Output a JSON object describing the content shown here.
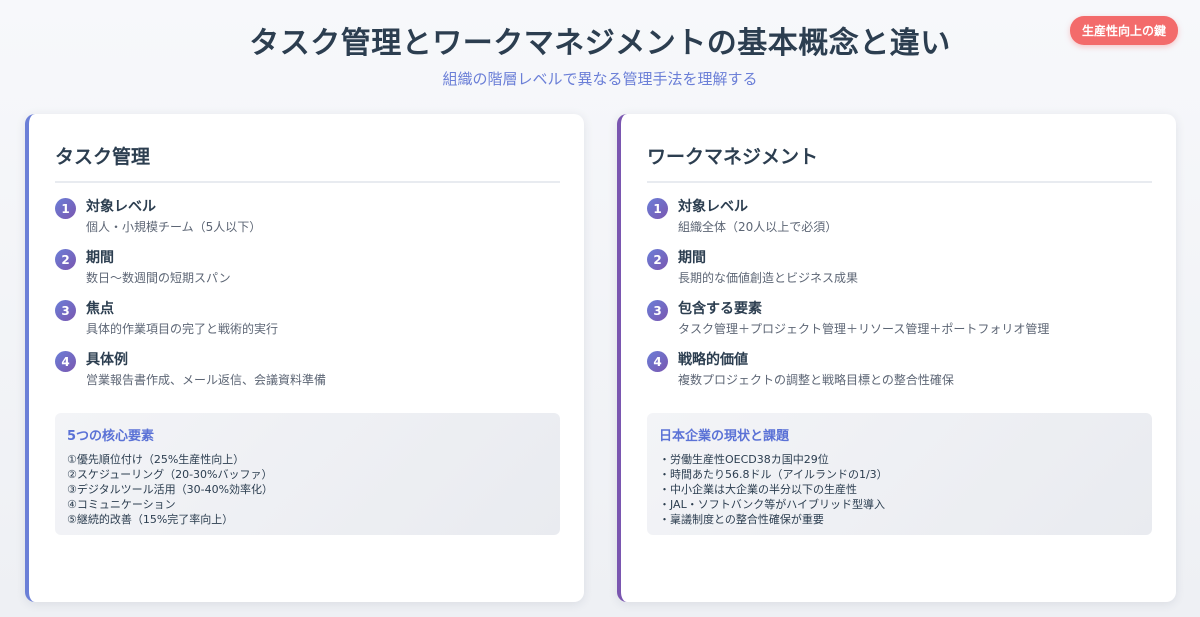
{
  "header": {
    "title": "タスク管理とワークマネジメントの基本概念と違い",
    "subtitle": "組織の階層レベルで異なる管理手法を理解する",
    "badge": "生産性向上の鍵"
  },
  "left": {
    "title": "タスク管理",
    "items": [
      {
        "num": "1",
        "label": "対象レベル",
        "desc": "個人・小規模チーム（5人以下）"
      },
      {
        "num": "2",
        "label": "期間",
        "desc": "数日〜数週間の短期スパン"
      },
      {
        "num": "3",
        "label": "焦点",
        "desc": "具体的作業項目の完了と戦術的実行"
      },
      {
        "num": "4",
        "label": "具体例",
        "desc": "営業報告書作成、メール返信、会議資料準備"
      }
    ],
    "box": {
      "title": "5つの核心要素",
      "lines": [
        "①優先順位付け（25%生産性向上）",
        "②スケジューリング（20-30%バッファ）",
        "③デジタルツール活用（30-40%効率化）",
        "④コミュニケーション",
        "⑤継続的改善（15%完了率向上）"
      ]
    }
  },
  "right": {
    "title": "ワークマネジメント",
    "items": [
      {
        "num": "1",
        "label": "対象レベル",
        "desc": "組織全体（20人以上で必須）"
      },
      {
        "num": "2",
        "label": "期間",
        "desc": "長期的な価値創造とビジネス成果"
      },
      {
        "num": "3",
        "label": "包含する要素",
        "desc": "タスク管理＋プロジェクト管理＋リソース管理＋ポートフォリオ管理"
      },
      {
        "num": "4",
        "label": "戦略的価値",
        "desc": "複数プロジェクトの調整と戦略目標との整合性確保"
      }
    ],
    "box": {
      "title": "日本企業の現状と課題",
      "lines": [
        "・労働生産性OECD38カ国中29位",
        "・時間あたり56.8ドル（アイルランドの1/3）",
        "・中小企業は大企業の半分以下の生産性",
        "・JAL・ソフトバンク等がハイブリッド型導入",
        "・稟議制度との整合性確保が重要"
      ]
    }
  }
}
